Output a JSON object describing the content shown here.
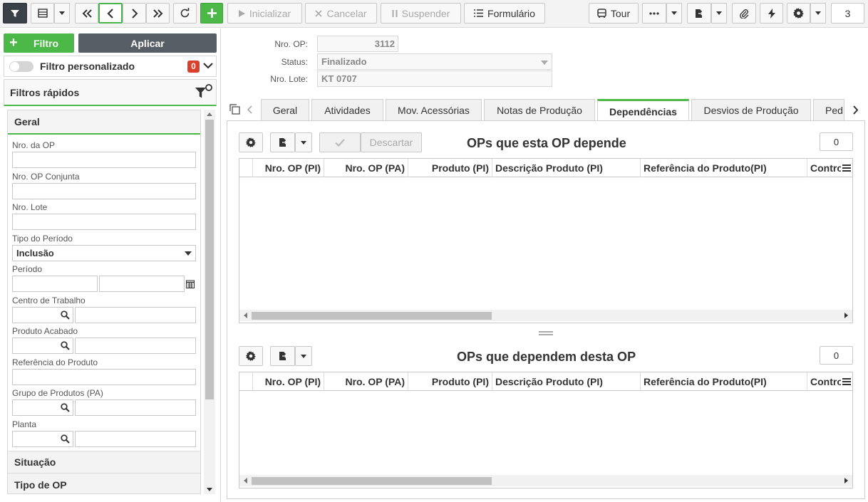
{
  "toolbar": {
    "inicializar": "Inicializar",
    "cancelar": "Cancelar",
    "suspender": "Suspender",
    "formulario": "Formulário",
    "tour": "Tour",
    "page_number": "3"
  },
  "left": {
    "filtro_button": "Filtro",
    "aplicar_button": "Aplicar",
    "filtro_personalizado": "Filtro personalizado",
    "filtro_count": "0",
    "filtros_rapidos": "Filtros rápidos",
    "geral": "Geral",
    "fields": {
      "nro_op": "Nro. da OP",
      "nro_op_conjunta": "Nro. OP Conjunta",
      "nro_lote": "Nro. Lote",
      "tipo_periodo": "Tipo do Período",
      "tipo_periodo_value": "Inclusão",
      "periodo": "Período",
      "centro_trabalho": "Centro de Trabalho",
      "produto_acabado": "Produto Acabado",
      "referencia_produto": "Referência do Produto",
      "grupo_produtos": "Grupo de Produtos (PA)",
      "planta": "Planta"
    },
    "situacao": "Situação",
    "tipo_op": "Tipo de OP"
  },
  "header": {
    "nro_op_label": "Nro. OP:",
    "nro_op_value": "3112",
    "status_label": "Status:",
    "status_value": "Finalizado",
    "nro_lote_label": "Nro. Lote:",
    "nro_lote_value": "KT 0707"
  },
  "tabs": [
    "Geral",
    "Atividades",
    "Mov. Acessórias",
    "Notas de Produção",
    "Dependências",
    "Desvios de Produção",
    "Ped"
  ],
  "grid1": {
    "descartar": "Descartar",
    "title": "OPs que esta OP depende",
    "count": "0",
    "columns": [
      "Nro. OP (PI)",
      "Nro. OP (PA)",
      "Produto (PI)",
      "Descrição Produto (PI)",
      "Referência do Produto(PI)",
      "Contro"
    ]
  },
  "grid2": {
    "title": "OPs que dependem desta OP",
    "count": "0",
    "columns": [
      "Nro. OP (PI)",
      "Nro. OP (PA)",
      "Produto (PI)",
      "Descrição Produto (PI)",
      "Referência do Produto(PI)",
      "Contro"
    ]
  }
}
